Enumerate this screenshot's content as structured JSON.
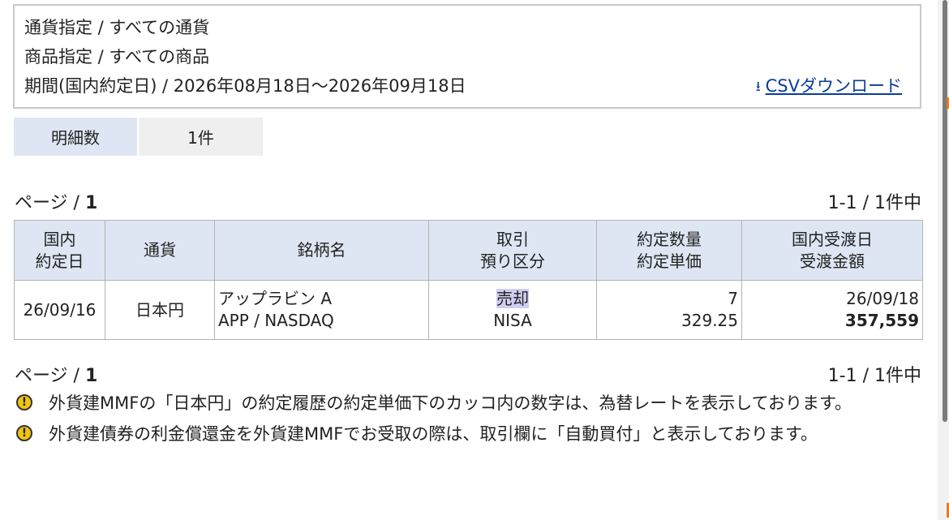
{
  "filters": {
    "currency": "通貨指定 / すべての通貨",
    "product": "商品指定 / すべての商品",
    "period": "期間(国内約定日) / 2026年08月18日～2026年09月18日",
    "csv_link": "CSVダウンロード"
  },
  "count": {
    "label": "明細数",
    "value": "1件"
  },
  "pager": {
    "prefix": "ページ / ",
    "current": "1",
    "range": "1-1 / 1件中"
  },
  "table": {
    "headers": [
      {
        "line1": "国内",
        "line2": "約定日"
      },
      {
        "line1": "通貨",
        "line2": ""
      },
      {
        "line1": "銘柄名",
        "line2": ""
      },
      {
        "line1": "取引",
        "line2": "預り区分"
      },
      {
        "line1": "約定数量",
        "line2": "約定単価"
      },
      {
        "line1": "国内受渡日",
        "line2": "受渡金額"
      }
    ],
    "rows": [
      {
        "trade_date": "26/09/16",
        "currency": "日本円",
        "name": "アップラビン A",
        "ticker": "APP / NASDAQ",
        "trade_type": "売却",
        "account": "NISA",
        "quantity": "7",
        "unit_price": "329.25",
        "settlement_date": "26/09/18",
        "settlement_amount": "357,559"
      }
    ]
  },
  "notes": [
    "外貨建MMFの「日本円」の約定履歴の約定単価下のカッコ内の数字は、為替レートを表示しております。",
    "外貨建債券の利金償還金を外貨建MMFでお受取の際は、取引欄に「自動買付」と表示しております。"
  ],
  "colors": {
    "header_bg": "#dde6f2",
    "link": "#0a3d9a",
    "highlight": "#cfcff2",
    "warning": "#f1c40f"
  },
  "icons": {
    "download": "download-icon",
    "warning": "warning-icon"
  }
}
